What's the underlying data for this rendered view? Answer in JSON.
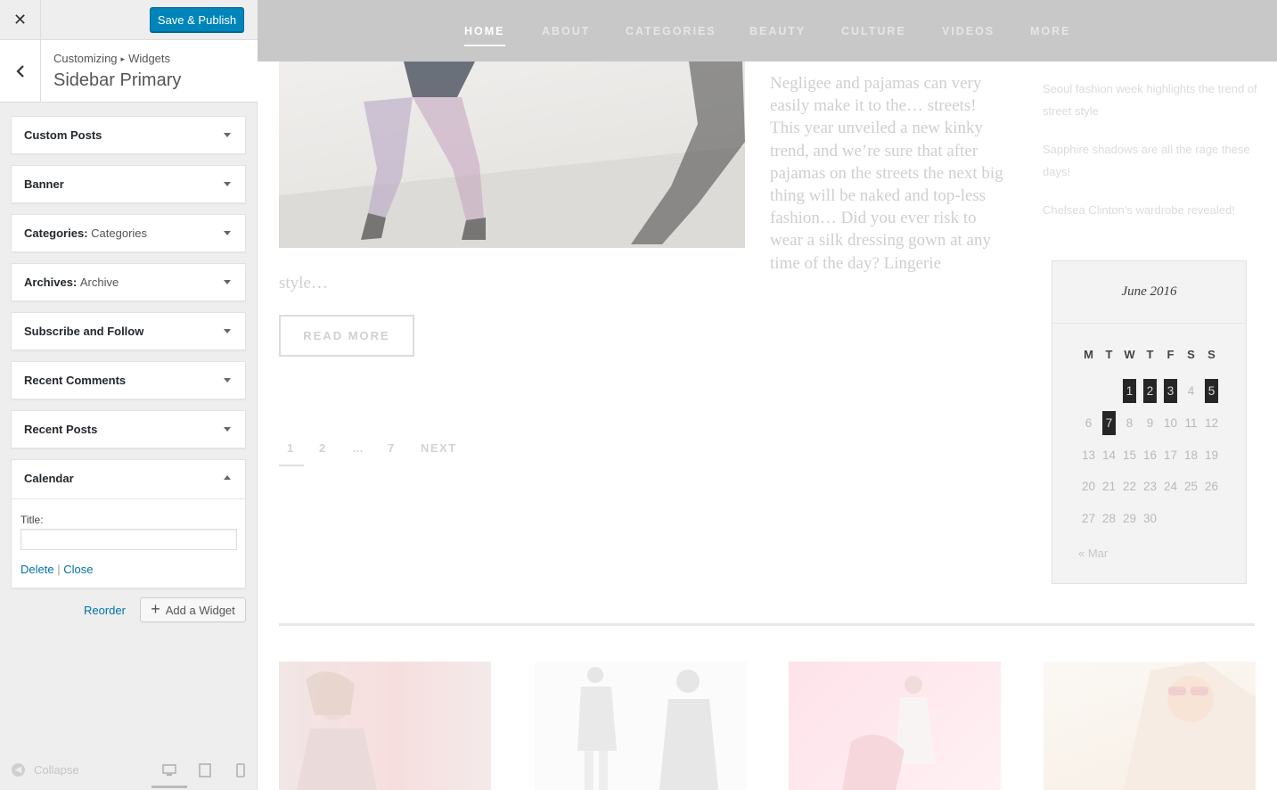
{
  "customizer": {
    "close_icon": "close-icon",
    "save_label": "Save & Publish",
    "breadcrumb": {
      "root": "Customizing",
      "separator": "▸",
      "section": "Widgets"
    },
    "panel_title": "Sidebar Primary",
    "widgets": [
      {
        "name": "Custom Posts",
        "sub": ""
      },
      {
        "name": "Banner",
        "sub": ""
      },
      {
        "name": "Categories:",
        "sub": "Categories"
      },
      {
        "name": "Archives:",
        "sub": "Archive"
      },
      {
        "name": "Subscribe and Follow",
        "sub": ""
      },
      {
        "name": "Recent Comments",
        "sub": ""
      },
      {
        "name": "Recent Posts",
        "sub": ""
      }
    ],
    "calendar_widget": {
      "name": "Calendar",
      "title_label": "Title:",
      "title_value": "",
      "delete_label": "Delete",
      "separator": "|",
      "close_label": "Close"
    },
    "reorder_label": "Reorder",
    "add_widget_label": "Add a Widget",
    "collapse_label": "Collapse",
    "accent_color": "#0085ba"
  },
  "preview": {
    "nav": [
      "HOME",
      "ABOUT",
      "CATEGORIES",
      "BEAUTY",
      "CULTURE",
      "VIDEOS",
      "MORE"
    ],
    "excerpt": "Negligee and pajamas can very easily make it to the… streets! This year unveiled a new kinky trend, and we’re sure that after pajamas on the streets the next big thing will be naked and top-less fashion… Did you ever risk to wear a silk dressing gown at any time of the day? Lingerie",
    "excerpt_tail": "style…",
    "read_more": "READ MORE",
    "pagination": [
      "1",
      "2",
      "…",
      "7",
      "NEXT"
    ],
    "recent_posts": [
      "Seoul fashion week highlights the trend of street style",
      "Sapphire shadows are all the rage these days!",
      "Chelsea Clinton’s wardrobe revealed!"
    ],
    "calendar": {
      "caption": "June 2016",
      "weekdays": [
        "M",
        "T",
        "W",
        "T",
        "F",
        "S",
        "S"
      ],
      "first_weekday_index": 2,
      "days_in_month": 30,
      "highlighted_days": [
        1,
        2,
        3,
        5,
        7
      ],
      "prev_link": "« Mar"
    }
  }
}
